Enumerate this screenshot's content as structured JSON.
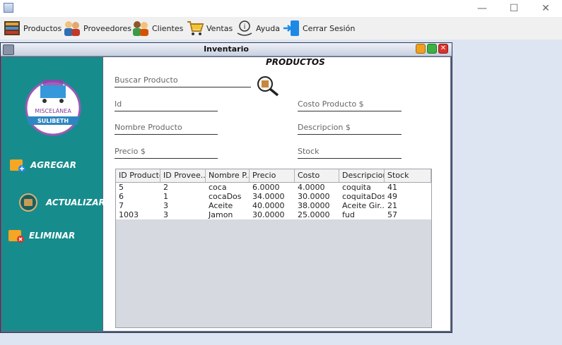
{
  "menubar": {
    "items": [
      {
        "label": "Productos",
        "icon": "products-shelf-icon"
      },
      {
        "label": "Proveedores",
        "icon": "suppliers-icon"
      },
      {
        "label": "Clientes",
        "icon": "clients-icon"
      },
      {
        "label": "Ventas",
        "icon": "cart-icon"
      },
      {
        "label": "Ayuda",
        "icon": "help-icon"
      },
      {
        "label": "Cerrar Sesión",
        "icon": "logout-icon"
      }
    ]
  },
  "window": {
    "title": "Inventario"
  },
  "sidebar": {
    "logo_text_top": "MISCELÁNEA",
    "logo_text_bottom": "SULIBETH",
    "buttons": [
      "AGREGAR",
      "ACTUALIZAR",
      "ELIMINAR"
    ]
  },
  "form": {
    "heading": "PRODUCTOS",
    "search_label": "Buscar Producto",
    "id_label": "Id",
    "cost_label": "Costo Producto $",
    "name_label": "Nombre Producto",
    "desc_label": "Descripcion $",
    "price_label": "Precio $",
    "stock_label": "Stock"
  },
  "table": {
    "columns": [
      "ID Producto",
      "ID Provee...",
      "Nombre P...",
      "Precio",
      "Costo",
      "Descripcion",
      "Stock"
    ],
    "rows": [
      [
        "5",
        "2",
        "coca",
        "6.0000",
        "4.0000",
        "coquita",
        "41"
      ],
      [
        "6",
        "1",
        "cocaDos",
        "34.0000",
        "30.0000",
        "coquitaDos",
        "49"
      ],
      [
        "7",
        "3",
        "Aceite",
        "40.0000",
        "38.0000",
        "Aceite Gir...",
        "21"
      ],
      [
        "1003",
        "3",
        "Jamon",
        "30.0000",
        "25.0000",
        "fud",
        "57"
      ]
    ]
  },
  "colors": {
    "sidebar": "#178c8c",
    "minimize": "#f0a020",
    "maximize": "#3cb043",
    "close": "#d9342b"
  }
}
